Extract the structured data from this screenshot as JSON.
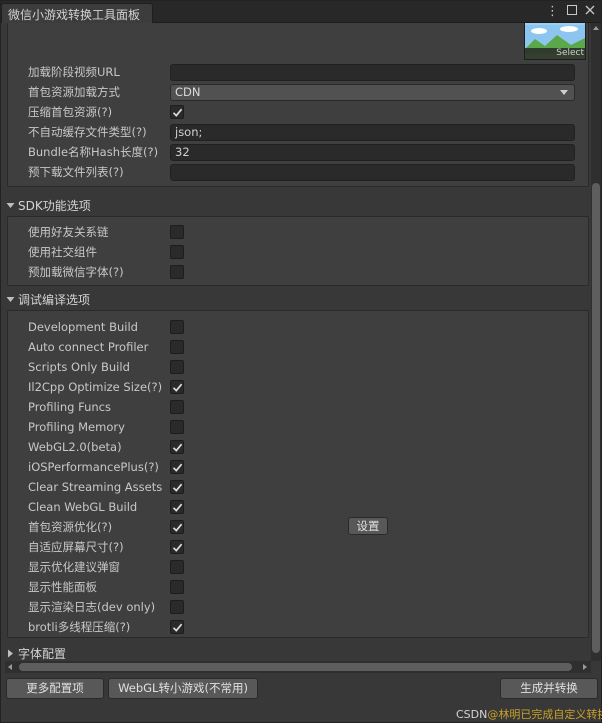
{
  "window": {
    "tab_title": "微信小游戏转换工具面板",
    "menu_icon": "kebab-menu-icon",
    "maximize_icon": "maximize-icon",
    "close_icon": "close-icon"
  },
  "thumbnail": {
    "select_label": "Select"
  },
  "basic": {
    "rows": [
      {
        "label": "加载阶段视频URL",
        "type": "text",
        "value": ""
      },
      {
        "label": "首包资源加载方式",
        "type": "dropdown",
        "value": "CDN"
      },
      {
        "label": "压缩首包资源(?)",
        "type": "checkbox",
        "checked": true
      },
      {
        "label": "不自动缓存文件类型(?)",
        "type": "text",
        "value": "json;"
      },
      {
        "label": "Bundle名称Hash长度(?)",
        "type": "text",
        "value": "32"
      },
      {
        "label": "预下载文件列表(?)",
        "type": "text",
        "value": ""
      }
    ]
  },
  "sdk": {
    "title": "SDK功能选项",
    "rows": [
      {
        "label": "使用好友关系链",
        "checked": false
      },
      {
        "label": "使用社交组件",
        "checked": false
      },
      {
        "label": "预加载微信字体(?)",
        "checked": false
      }
    ]
  },
  "debug": {
    "title": "调试编译选项",
    "rows": [
      {
        "label": "Development Build",
        "checked": false
      },
      {
        "label": "Auto connect Profiler",
        "checked": false
      },
      {
        "label": "Scripts Only Build",
        "checked": false
      },
      {
        "label": "Il2Cpp Optimize Size(?)",
        "checked": true
      },
      {
        "label": "Profiling Funcs",
        "checked": false
      },
      {
        "label": "Profiling Memory",
        "checked": false
      },
      {
        "label": "WebGL2.0(beta)",
        "checked": true
      },
      {
        "label": "iOSPerformancePlus(?)",
        "checked": true
      },
      {
        "label": "Clear Streaming Assets",
        "checked": true
      },
      {
        "label": "Clean WebGL Build",
        "checked": true
      },
      {
        "label": "首包资源优化(?)",
        "checked": true
      },
      {
        "label": "自适应屏幕尺寸(?)",
        "checked": true
      },
      {
        "label": "显示优化建议弹窗",
        "checked": false
      },
      {
        "label": "显示性能面板",
        "checked": false
      },
      {
        "label": "显示渲染日志(dev only)",
        "checked": false
      },
      {
        "label": "brotli多线程压缩(?)",
        "checked": true
      }
    ],
    "settings_button": "设置"
  },
  "font": {
    "title": "字体配置"
  },
  "footer": {
    "more_config": "更多配置项",
    "webgl_convert": "WebGL转小游戏(不常用)",
    "build_convert": "生成并转换"
  },
  "watermark": {
    "prefix": "CSDN",
    "text": "@林明已完成自定义转换"
  },
  "colors": {
    "panel_bg": "#383838",
    "section_bg": "#3f3f3f",
    "field_bg": "#2a2a2a",
    "button_bg": "#585858",
    "check": "#dcdcdc"
  }
}
